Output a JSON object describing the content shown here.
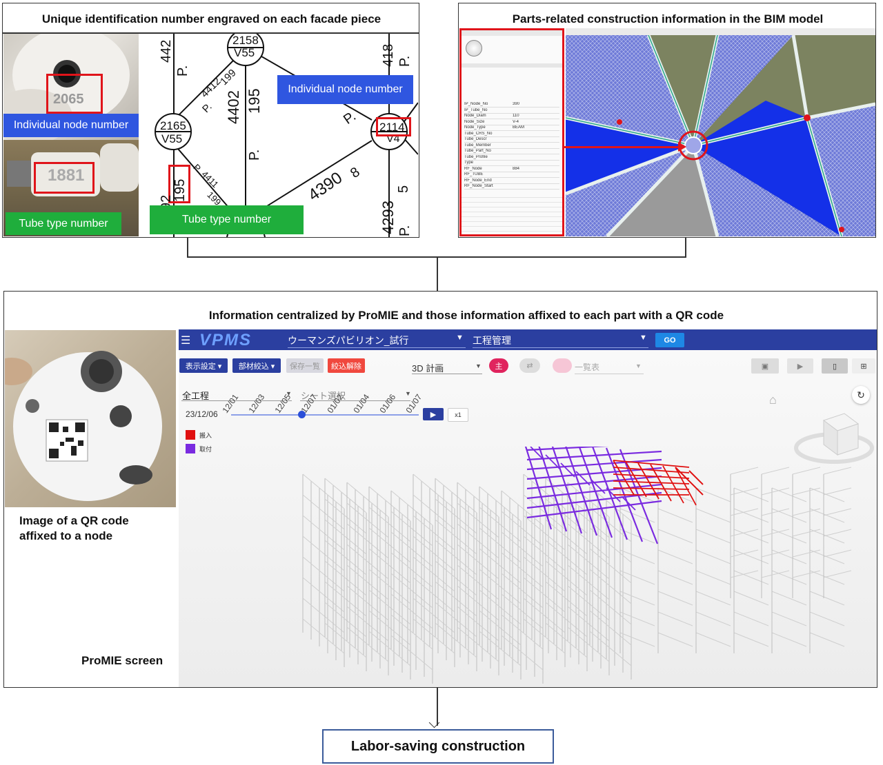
{
  "top_left": {
    "title": "Unique identification number engraved on each facade piece",
    "photo_node_tag": "Individual node number",
    "photo_tube_tag": "Tube type number",
    "photo_node_engraving": "2065",
    "photo_tube_engraving": "1881",
    "drawing_node_tag": "Individual node number",
    "drawing_tube_tag": "Tube type number",
    "drawing_labels": {
      "node_top": "2158",
      "node_top_sub": "V55",
      "node_left": "2165",
      "node_left_sub": "V55",
      "node_right": "2114",
      "node_right_sub": "V4",
      "tube_mid": "4402",
      "tube_mid_b": "195",
      "tube_mid_c": "P.",
      "tube_left": "195",
      "tube_upper_left": "4412",
      "tube_upper_left_b": "199",
      "tube_upper_left_c": "P.",
      "tube_lower_left": "4411",
      "tube_lower_left_b": "199",
      "tube_lower_left_c": "P.",
      "tube_right": "4390",
      "tube_right_b": "8",
      "tube_right_c": "P.",
      "tube_far_right_top": "418",
      "tube_far_right_top_b": "P.",
      "tube_far_right_bottom": "4293",
      "tube_far_right_bottom_b": "5",
      "tube_far_right_bottom_c": "P.",
      "tube_far_left": "442",
      "tube_far_left_b": "P.",
      "tube_bottom_left": "92"
    }
  },
  "top_right": {
    "title": "Parts-related construction information in the BIM model",
    "properties": [
      "IP_Node_No",
      "IP_Tube_No",
      "Node_Diam",
      "Node_Size",
      "Node_Type",
      "Tube_CRS_No",
      "Tube_Descr",
      "Tube_Member",
      "Tube_Part_No",
      "Tube_Profile",
      "Type",
      "RF_Node",
      "RF_TUBE",
      "RF_Node_End",
      "RF_Node_Start"
    ],
    "values": [
      "390",
      "",
      "110",
      "V-4",
      "BEAM",
      "",
      "",
      "",
      "",
      "",
      "",
      "884",
      "",
      "",
      ""
    ]
  },
  "middle": {
    "title": "Information centralized by ProMIE and those information affixed to each part with a QR code",
    "qr_caption_line1": "Image of a QR code",
    "qr_caption_line2": "affixed to a node",
    "promie_label": "ProMIE screen",
    "app": {
      "logo": "VPMS",
      "project": "ウーマンズパビリオン_試行",
      "module": "工程管理",
      "go_button": "GO",
      "btn_display": "表示設定 ▾",
      "btn_filter": "部材絞込 ▾",
      "btn_save": "保存一覧",
      "btn_clear": "絞込解除",
      "view_select": "3D 計画",
      "main_badge": "主",
      "list_label": "一覧表",
      "process_select": "全工程",
      "sheet_select": "シート選択",
      "date": "23/12/06",
      "timeline_dates": [
        "12/01",
        "12/03",
        "12/05",
        "12/07",
        "01/02",
        "01/04",
        "01/06",
        "01/07"
      ],
      "speed": "x1",
      "legend": [
        {
          "label": "搬入",
          "color": "#e01010"
        },
        {
          "label": "取付",
          "color": "#7a2be0"
        }
      ]
    }
  },
  "bottom": {
    "box_label": "Labor-saving construction"
  }
}
